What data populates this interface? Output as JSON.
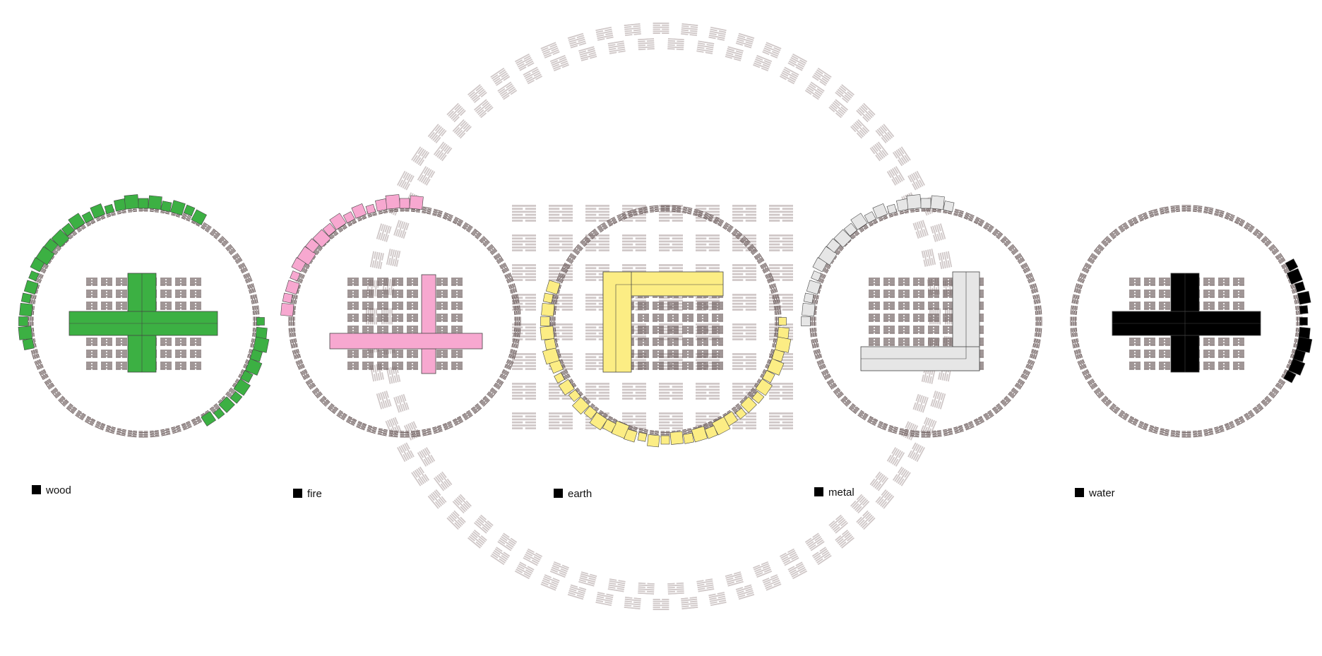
{
  "panels": [
    {
      "id": "wood",
      "label": "wood",
      "color": "#3cb043",
      "cross": "plus",
      "arcs": [
        [
          165,
          300
        ],
        [
          0,
          60
        ]
      ]
    },
    {
      "id": "fire",
      "label": "fire",
      "color": "#f7a8d0",
      "cross": "plus-low",
      "arcs": [
        [
          185,
          280
        ]
      ]
    },
    {
      "id": "earth",
      "label": "earth",
      "color": "#fced84",
      "cross": "corner-tl",
      "arcs": [
        [
          -10,
          200
        ]
      ]
    },
    {
      "id": "metal",
      "label": "metal",
      "color": "#e6e6e6",
      "cross": "corner-br",
      "arcs": [
        [
          175,
          285
        ]
      ]
    },
    {
      "id": "water",
      "label": "water",
      "color": "#000000",
      "cross": "plus",
      "arcs": [
        [
          330,
          360
        ],
        [
          0,
          30
        ]
      ]
    }
  ],
  "colors": {
    "ring_glyph": "#6b5b5b",
    "bg_glyph": "#cfc7c7",
    "legend_swatch": "#000000",
    "outline": "#444444"
  },
  "icons": [
    "hexagram-glyph",
    "legend-swatch"
  ]
}
